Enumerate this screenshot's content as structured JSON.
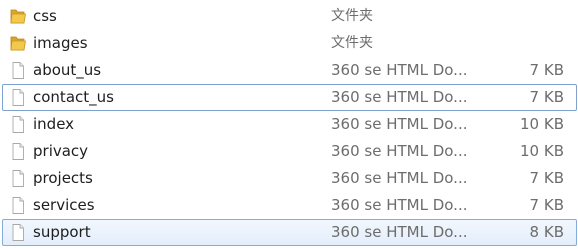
{
  "files": [
    {
      "name": "css",
      "type": "文件夹",
      "size": "",
      "icon": "folder-icon"
    },
    {
      "name": "images",
      "type": "文件夹",
      "size": "",
      "icon": "folder-icon"
    },
    {
      "name": "about_us",
      "type": "360 se HTML Do...",
      "size": "7 KB",
      "icon": "document-icon"
    },
    {
      "name": "contact_us",
      "type": "360 se HTML Do...",
      "size": "7 KB",
      "icon": "document-icon"
    },
    {
      "name": "index",
      "type": "360 se HTML Do...",
      "size": "10 KB",
      "icon": "document-icon"
    },
    {
      "name": "privacy",
      "type": "360 se HTML Do...",
      "size": "10 KB",
      "icon": "document-icon"
    },
    {
      "name": "projects",
      "type": "360 se HTML Do...",
      "size": "7 KB",
      "icon": "document-icon"
    },
    {
      "name": "services",
      "type": "360 se HTML Do...",
      "size": "7 KB",
      "icon": "document-icon"
    },
    {
      "name": "support",
      "type": "360 se HTML Do...",
      "size": "8 KB",
      "icon": "document-icon"
    }
  ],
  "colors": {
    "folder": "#e8b73a",
    "selection_border": "#84acdd",
    "focus_border": "#7da2ce",
    "secondary_text": "#6d6d6d"
  }
}
